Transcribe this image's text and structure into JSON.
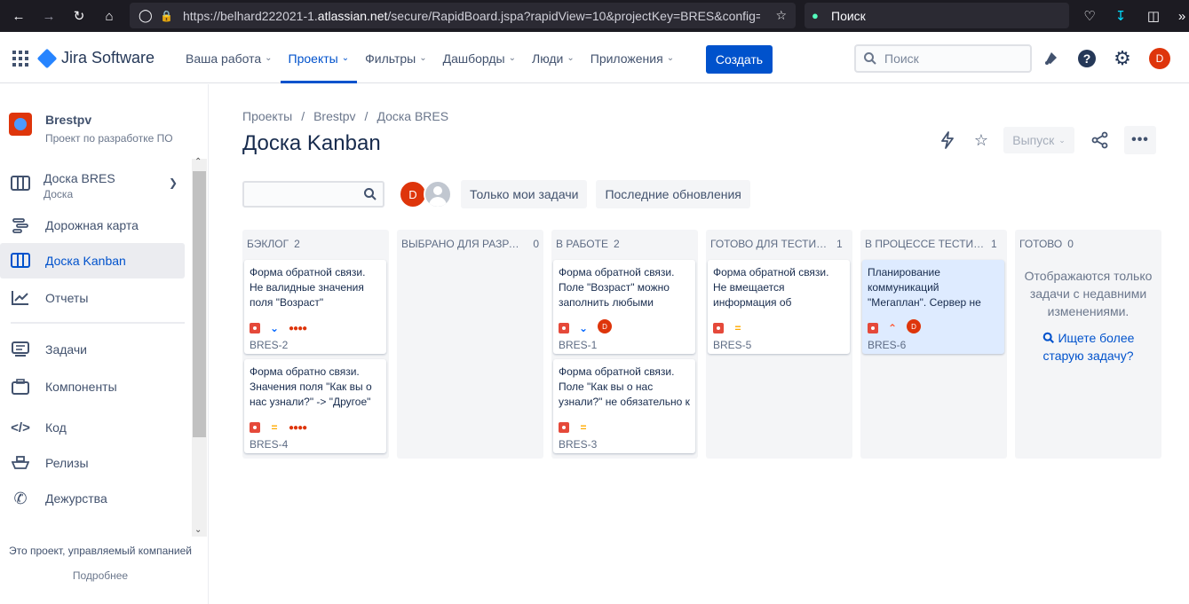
{
  "browser": {
    "url_prefix": "https://belhard222021-1.",
    "url_domain": "atlassian.net",
    "url_suffix": "/secure/RapidBoard.jspa?rapidView=10&projectKey=BRES&config=co",
    "search_placeholder": "Поиск"
  },
  "nav": {
    "product": "Jira Software",
    "items": [
      {
        "label": "Ваша работа"
      },
      {
        "label": "Проекты"
      },
      {
        "label": "Фильтры"
      },
      {
        "label": "Дашборды"
      },
      {
        "label": "Люди"
      },
      {
        "label": "Приложения"
      }
    ],
    "create_label": "Создать",
    "search_placeholder": "Поиск",
    "user_initial": "D"
  },
  "sidebar": {
    "project_name": "Brestpv",
    "project_type": "Проект по разработке ПО",
    "board_name": "Доска BRES",
    "board_type": "Доска",
    "items": [
      {
        "label": "Дорожная карта"
      },
      {
        "label": "Доска Kanban"
      },
      {
        "label": "Отчеты"
      },
      {
        "label": "Задачи"
      },
      {
        "label": "Компоненты"
      },
      {
        "label": "Код"
      },
      {
        "label": "Релизы"
      },
      {
        "label": "Дежурства"
      }
    ],
    "footer_text": "Это проект, управляемый компанией",
    "footer_link": "Подробнее"
  },
  "main": {
    "breadcrumb": [
      "Проекты",
      "Brestpv",
      "Доска BRES"
    ],
    "title": "Доска Kanban",
    "release_label": "Выпуск",
    "avatar_initial": "D",
    "quick_filters": [
      "Только мои задачи",
      "Последние обновления"
    ]
  },
  "board": {
    "columns": [
      {
        "name": "Бэклог",
        "count": "2"
      },
      {
        "name": "Выбрано для разраб...",
        "count": "0"
      },
      {
        "name": "В работе",
        "count": "2"
      },
      {
        "name": "Готово для тестиров...",
        "count": "1"
      },
      {
        "name": "В процессе тестиров...",
        "count": "1"
      },
      {
        "name": "Готово",
        "count": "0"
      }
    ],
    "cards": {
      "bres2": {
        "summary": "Форма обратной связи. Не валидные значения поля \"Возраст\" отправляется",
        "key": "BRES-2"
      },
      "bres4": {
        "summary": "Форма обратно связи. Значения поля \"Как вы о нас узнали?\" -> \"Другое\"",
        "key": "BRES-4"
      },
      "bres1": {
        "summary": "Форма обратной связи. Поле \"Возраст\" можно заполнить любыми",
        "key": "BRES-1",
        "assignee": "D"
      },
      "bres3": {
        "summary": "Форма обратной связи. Поле \"Как вы о нас узнали?\" не обязательно к",
        "key": "BRES-3"
      },
      "bres5": {
        "summary": "Форма обратной связи. Не вмещается информация об отправленных",
        "key": "BRES-5"
      },
      "bres6": {
        "summary": "Планирование коммуникаций \"Мегаплан\". Сервер не",
        "key": "BRES-6",
        "assignee": "D"
      }
    },
    "done_message": "Отображаются только задачи с недавними изменениями.",
    "done_link": "Ищете более старую задачу?"
  }
}
